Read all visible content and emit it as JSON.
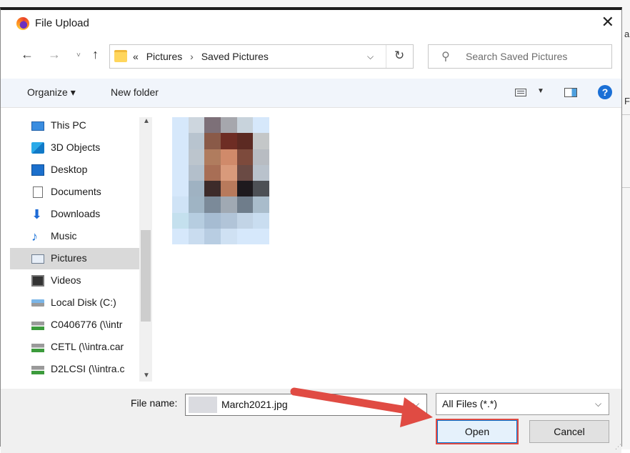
{
  "dialog": {
    "title": "File Upload",
    "close_glyph": "✕"
  },
  "nav": {
    "back_glyph": "←",
    "forward_glyph": "→",
    "recent_glyph": "˅",
    "up_glyph": "↑"
  },
  "address": {
    "overflow": "«",
    "crumbs": [
      "Pictures",
      "Saved Pictures"
    ],
    "separator": "›",
    "dropdown_glyph": "⌵",
    "refresh_glyph": "↻"
  },
  "search": {
    "placeholder": "Search Saved Pictures",
    "icon": "search-icon"
  },
  "toolbar": {
    "organize": "Organize ▾",
    "new_folder": "New folder",
    "view_drop_glyph": "▼",
    "help_glyph": "?"
  },
  "sidebar": {
    "items": [
      {
        "label": "This PC",
        "icon": "computer-icon",
        "selected": false
      },
      {
        "label": "3D Objects",
        "icon": "cube-icon",
        "selected": false
      },
      {
        "label": "Desktop",
        "icon": "desktop-icon",
        "selected": false
      },
      {
        "label": "Documents",
        "icon": "document-icon",
        "selected": false
      },
      {
        "label": "Downloads",
        "icon": "download-arrow-icon",
        "selected": false
      },
      {
        "label": "Music",
        "icon": "music-note-icon",
        "selected": false
      },
      {
        "label": "Pictures",
        "icon": "pictures-icon",
        "selected": true
      },
      {
        "label": "Videos",
        "icon": "film-icon",
        "selected": false
      },
      {
        "label": "Local Disk (C:)",
        "icon": "disk-icon",
        "selected": false
      },
      {
        "label": "C0406776 (\\\\intr",
        "icon": "network-drive-icon",
        "selected": false
      },
      {
        "label": "CETL (\\\\intra.car",
        "icon": "network-drive-icon",
        "selected": false
      },
      {
        "label": "D2LCSI (\\\\intra.c",
        "icon": "network-drive-icon",
        "selected": false
      }
    ],
    "scroll_up_glyph": "▲",
    "scroll_down_glyph": "▼"
  },
  "footer": {
    "file_name_label": "File name:",
    "file_name_value": "March2021.jpg",
    "file_type_value": "All Files (*.*)",
    "dropdown_glyph": "⌵",
    "open_label": "Open",
    "cancel_label": "Cancel",
    "grip_glyph": "⋰"
  },
  "background": {
    "fragments": [
      "a",
      "F"
    ]
  },
  "colors": {
    "annotation_red": "#e04b43",
    "accent_blue": "#0078d7",
    "selected_bg": "#d9d9d9"
  }
}
